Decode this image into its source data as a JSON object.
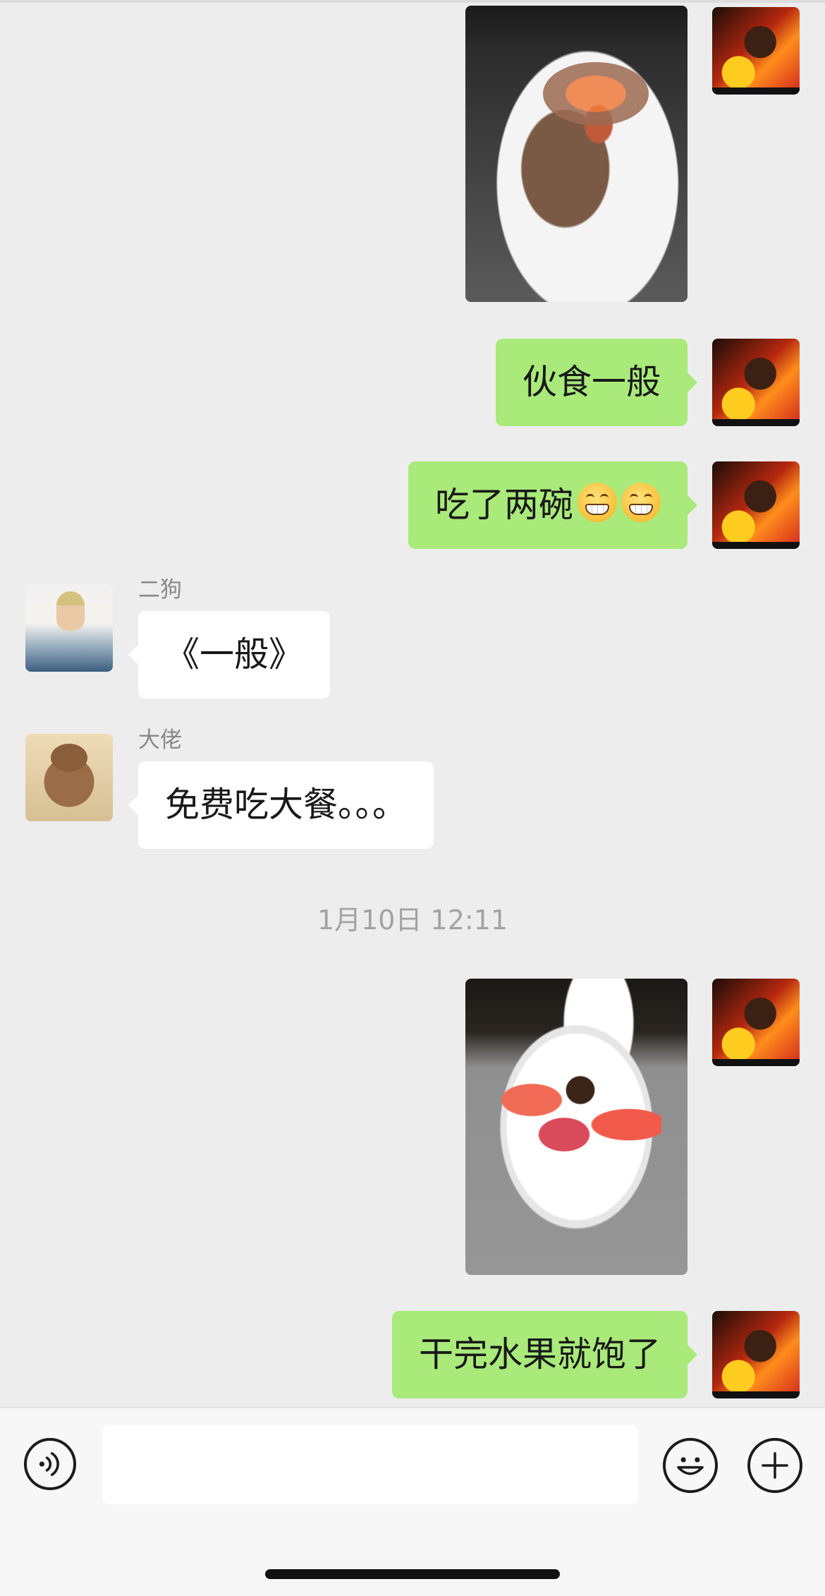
{
  "chat": {
    "messages": [
      {
        "type": "image",
        "sender": "self",
        "image": "food-plate-photo"
      },
      {
        "type": "text",
        "sender": "self",
        "text": "伙食一般"
      },
      {
        "type": "text",
        "sender": "self",
        "text": "吃了两碗",
        "emoji": [
          "grinning-face-emoji",
          "grinning-face-emoji"
        ]
      },
      {
        "type": "text",
        "sender": "other",
        "name": "二狗",
        "text": "《一般》"
      },
      {
        "type": "text",
        "sender": "other",
        "name": "大佬",
        "text": "免费吃大餐。。。"
      },
      {
        "type": "timestamp",
        "text": "1月10日 12:11"
      },
      {
        "type": "image",
        "sender": "self",
        "image": "fruit-plate-photo"
      },
      {
        "type": "text",
        "sender": "self",
        "text": "干完水果就饱了"
      }
    ]
  },
  "input_bar": {
    "input_value": "",
    "icons": [
      "voice-icon",
      "emoji-icon",
      "plus-icon"
    ]
  },
  "colors": {
    "background": "#ededed",
    "outgoing_bubble": "#a9ea7a",
    "incoming_bubble": "#ffffff",
    "sender_name": "#888888",
    "timestamp": "#a2a2a2"
  }
}
